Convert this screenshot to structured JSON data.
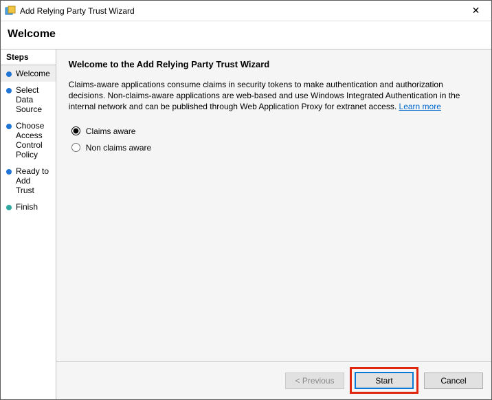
{
  "window": {
    "title": "Add Relying Party Trust Wizard",
    "close": "✕"
  },
  "page_heading": "Welcome",
  "sidebar": {
    "header": "Steps",
    "items": [
      {
        "label": "Welcome",
        "color": "blue",
        "active": true
      },
      {
        "label": "Select Data Source",
        "color": "blue",
        "active": false
      },
      {
        "label": "Choose Access Control Policy",
        "color": "blue",
        "active": false
      },
      {
        "label": "Ready to Add Trust",
        "color": "blue",
        "active": false
      },
      {
        "label": "Finish",
        "color": "teal",
        "active": false
      }
    ]
  },
  "main": {
    "title": "Welcome to the Add Relying Party Trust Wizard",
    "desc": "Claims-aware applications consume claims in security tokens to make authentication and authorization decisions. Non-claims-aware applications are web-based and use Windows Integrated Authentication in the internal network and can be published through Web Application Proxy for extranet access. ",
    "learn_more": "Learn more",
    "options": {
      "claims": "Claims aware",
      "non_claims": "Non claims aware",
      "selected": "claims"
    }
  },
  "footer": {
    "previous": "< Previous",
    "start": "Start",
    "cancel": "Cancel"
  }
}
